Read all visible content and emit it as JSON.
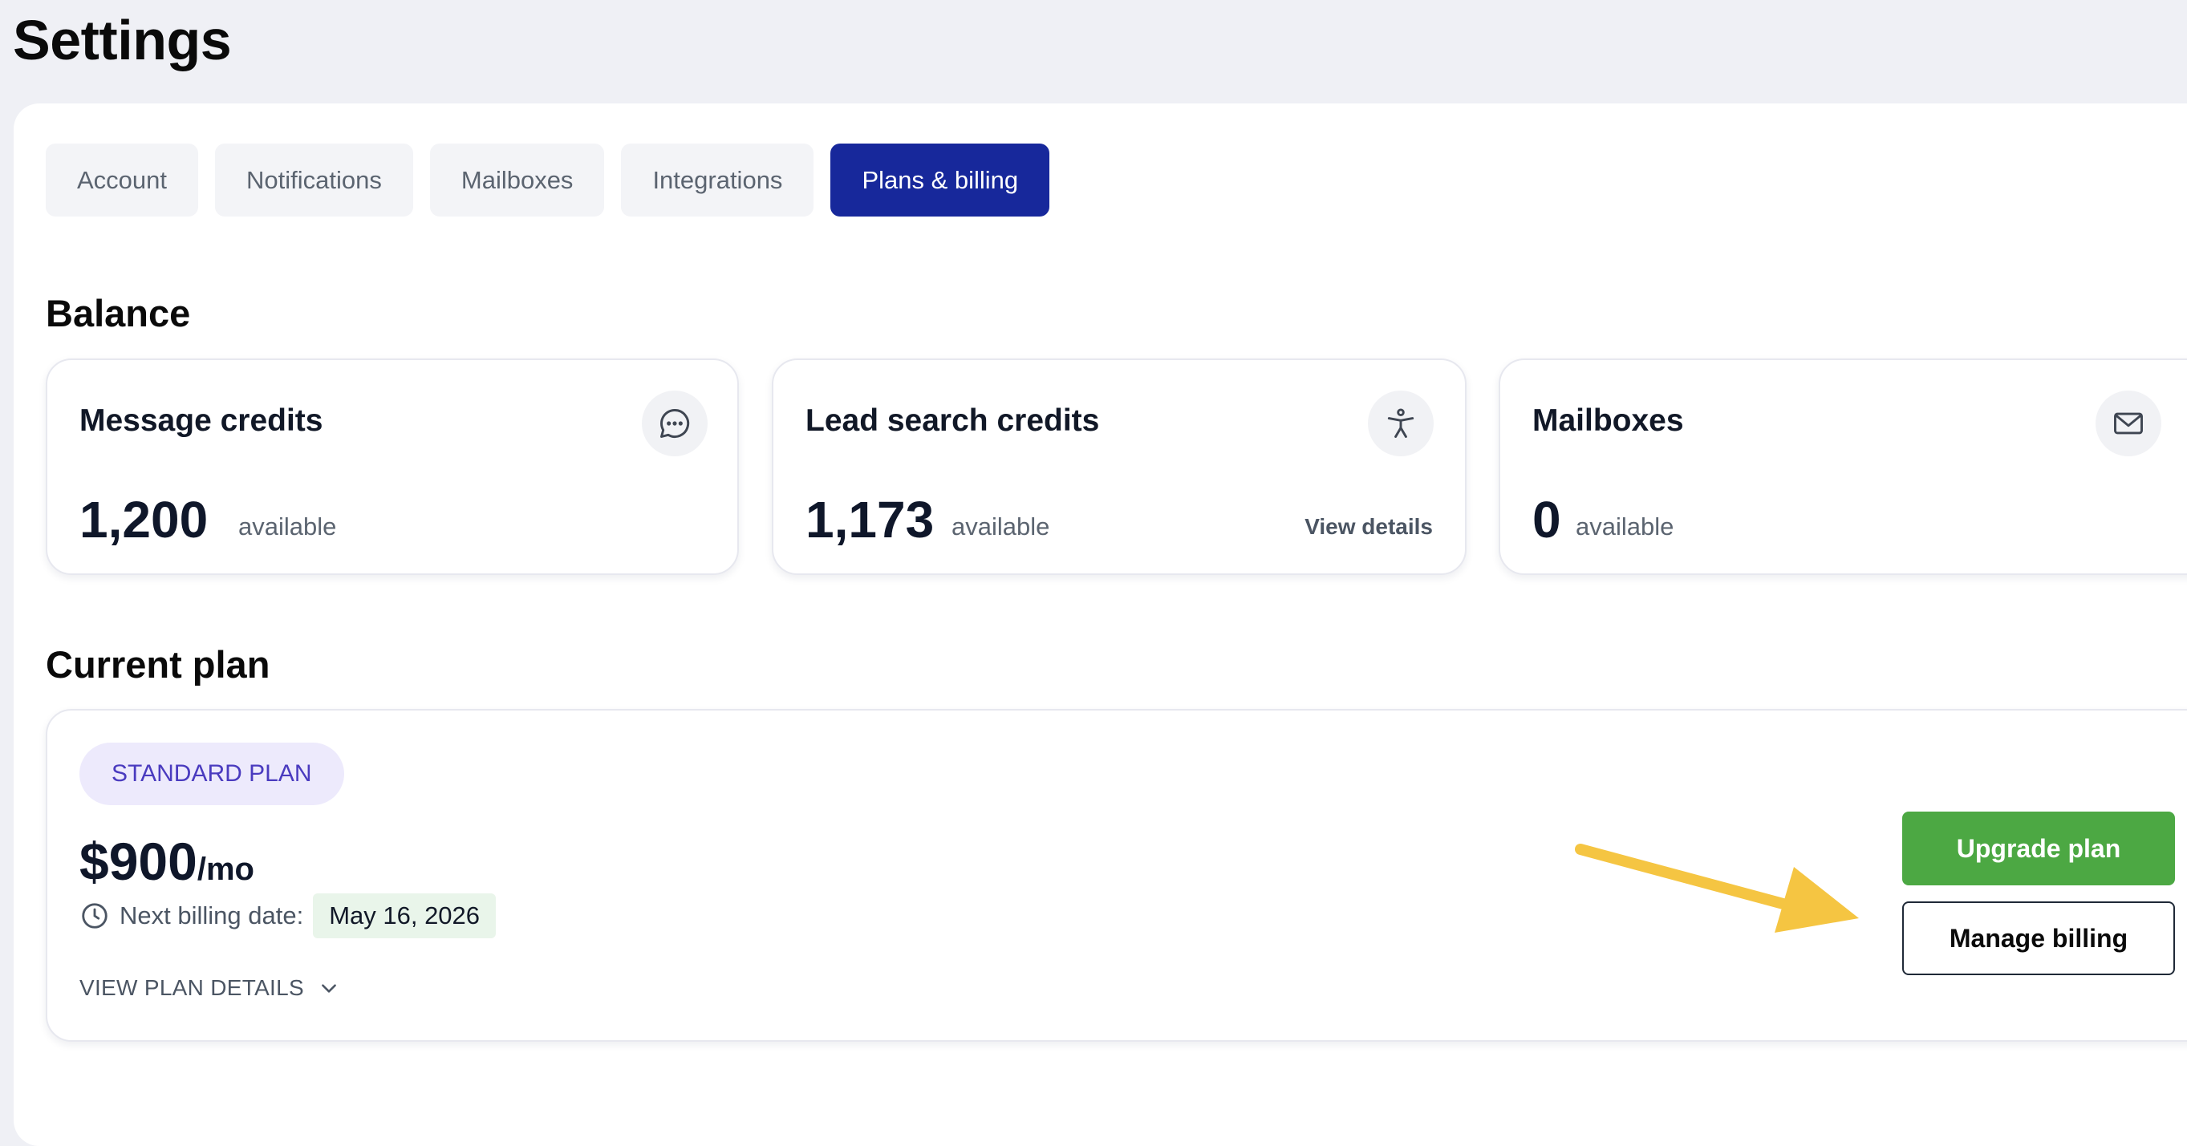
{
  "page": {
    "title": "Settings"
  },
  "tabs": [
    {
      "label": "Account"
    },
    {
      "label": "Notifications"
    },
    {
      "label": "Mailboxes"
    },
    {
      "label": "Integrations"
    },
    {
      "label": "Plans & billing",
      "active": true
    }
  ],
  "balance": {
    "title": "Balance",
    "cards": [
      {
        "title": "Message credits",
        "value": "1,200",
        "unit": "available",
        "icon": "chat-bubble-icon"
      },
      {
        "title": "Lead search credits",
        "value": "1,173",
        "unit": "available",
        "link": "View details",
        "icon": "accessibility-person-icon"
      },
      {
        "title": "Mailboxes",
        "value": "0",
        "unit": "available",
        "icon": "envelope-icon"
      }
    ]
  },
  "current_plan": {
    "title": "Current plan",
    "badge": "STANDARD PLAN",
    "price": "$900",
    "period": "/mo",
    "next_billing_label": "Next billing date:",
    "next_billing_date": "May 16, 2026",
    "details_link": "VIEW PLAN DETAILS",
    "upgrade_label": "Upgrade plan",
    "manage_label": "Manage billing"
  },
  "colors": {
    "active_tab": "#17289b",
    "upgrade_button": "#4ca843",
    "annotation_arrow": "#f5c542",
    "badge_text": "#4a3bbf"
  }
}
